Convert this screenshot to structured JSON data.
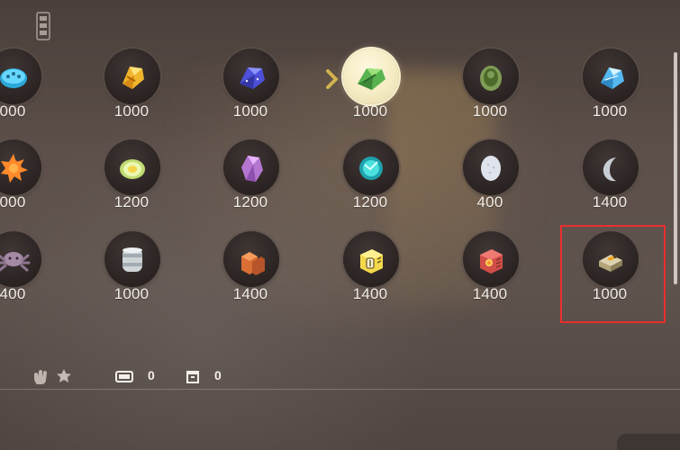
{
  "shop": {
    "rows": [
      {
        "items": [
          {
            "price": "000",
            "icon": "blue-disc-icon"
          },
          {
            "price": "1000",
            "icon": "amber-crystal-icon"
          },
          {
            "price": "1000",
            "icon": "blue-gem-icon"
          },
          {
            "price": "1000",
            "icon": "green-crystal-icon",
            "selected": true
          },
          {
            "price": "1000",
            "icon": "green-stone-icon"
          },
          {
            "price": "1000",
            "icon": "blue-diamond-icon"
          }
        ]
      },
      {
        "items": [
          {
            "price": "000",
            "icon": "orange-star-icon"
          },
          {
            "price": "1200",
            "icon": "green-egg-icon"
          },
          {
            "price": "1200",
            "icon": "purple-crystal-icon"
          },
          {
            "price": "1200",
            "icon": "teal-orb-icon"
          },
          {
            "price": "400",
            "icon": "white-egg-icon"
          },
          {
            "price": "1400",
            "icon": "moon-icon"
          }
        ]
      },
      {
        "items": [
          {
            "price": "400",
            "icon": "purple-spider-icon"
          },
          {
            "price": "1000",
            "icon": "silver-barrel-icon"
          },
          {
            "price": "1400",
            "icon": "orange-blocks-icon"
          },
          {
            "price": "1400",
            "icon": "yellow-box-icon"
          },
          {
            "price": "1400",
            "icon": "red-box-icon"
          },
          {
            "price": "1000",
            "icon": "machine-part-icon",
            "highlighted": true
          }
        ]
      }
    ]
  },
  "status": {
    "cart_count": "0",
    "storage_count": "0"
  },
  "colors": {
    "highlight": "#ea2f2f",
    "selected_circle": "#f5ebc3",
    "text": "#f1ece6"
  }
}
